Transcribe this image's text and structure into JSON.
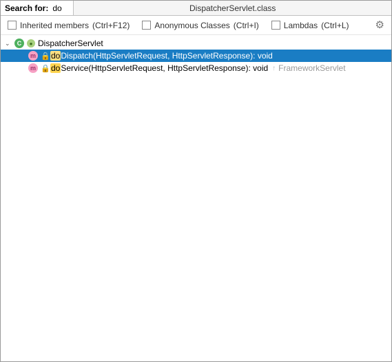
{
  "header": {
    "search_label": "Search for:",
    "search_value": "do",
    "title": "DispatcherServlet.class"
  },
  "toolbar": {
    "inherited": {
      "label": "Inherited members",
      "shortcut": "(Ctrl+F12)"
    },
    "anonymous": {
      "label": "Anonymous Classes",
      "shortcut": "(Ctrl+I)"
    },
    "lambdas": {
      "label": "Lambdas",
      "shortcut": "(Ctrl+L)"
    }
  },
  "tree": {
    "root": {
      "name": "DispatcherServlet"
    },
    "items": [
      {
        "match": "do",
        "rest": "Dispatch",
        "params": "(HttpServletRequest, HttpServletResponse)",
        "returns": ": void",
        "selected": true
      },
      {
        "match": "do",
        "rest": "Service",
        "params": "(HttpServletRequest, HttpServletResponse)",
        "returns": ": void",
        "selected": false,
        "inherited_from": "FrameworkServlet"
      }
    ]
  }
}
